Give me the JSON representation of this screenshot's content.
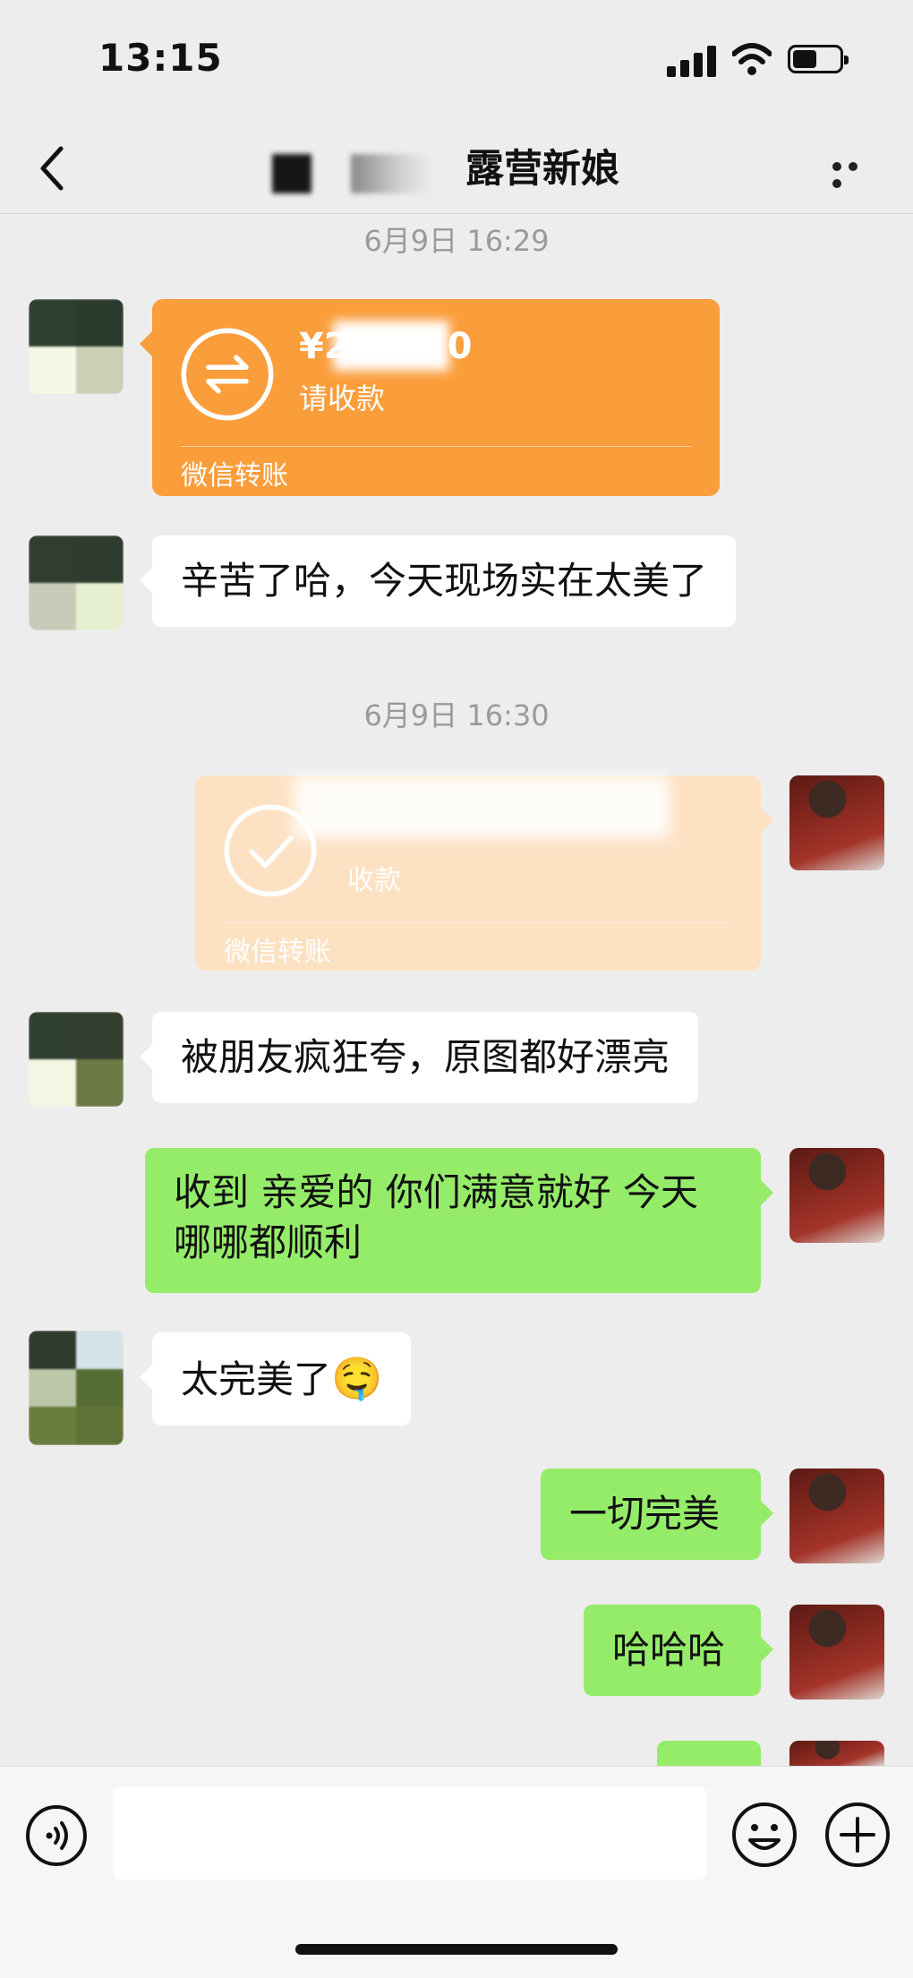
{
  "status_bar": {
    "time": "13:15"
  },
  "header": {
    "title": "露营新娘"
  },
  "messages": {
    "ts1": "6月9日 16:29",
    "transfer1": {
      "amount": "¥2",
      "amount_tail": "0",
      "status": "请收款",
      "label": "微信转账"
    },
    "m1": "辛苦了哈，今天现场实在太美了",
    "ts2": "6月9日 16:30",
    "transfer2": {
      "status": "收款",
      "label": "微信转账"
    },
    "m2": "被朋友疯狂夸，原图都好漂亮",
    "m3_line1": "收到 亲爱的 你们满意就好 今天",
    "m3_line2": "哪哪都顺利",
    "m4": "太完美了",
    "m4_emoji": "🤤",
    "m5": "一切完美",
    "m6": "哈哈哈"
  },
  "input": {
    "value": ""
  },
  "colors": {
    "self_bubble": "#95ec69",
    "transfer_orange": "#fa9d3b",
    "transfer_received": "#fde1c3",
    "background": "#ededed"
  }
}
